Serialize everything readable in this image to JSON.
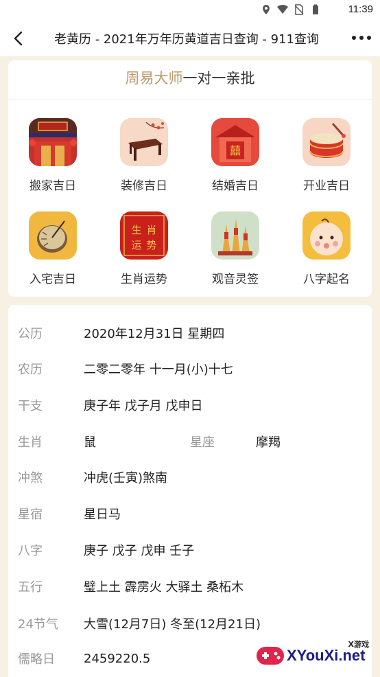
{
  "status_bar": {
    "time": "11:39",
    "icons": [
      "location-icon",
      "wifi-icon",
      "no-sim-icon",
      "battery-icon"
    ]
  },
  "header": {
    "title": "老黄历 - 2021年万年历黄道吉日查询 - 911查询",
    "back_icon": "back-arrow-icon",
    "more_icon": "more-icon"
  },
  "master_card": {
    "title_accent": "周易大师",
    "title_rest": "一对一亲批",
    "items": [
      {
        "label": "搬家吉日",
        "icon": "moving-house-icon"
      },
      {
        "label": "装修吉日",
        "icon": "renovation-table-icon"
      },
      {
        "label": "结婚吉日",
        "icon": "wedding-icon"
      },
      {
        "label": "开业吉日",
        "icon": "drum-icon"
      },
      {
        "label": "入宅吉日",
        "icon": "sundial-icon"
      },
      {
        "label": "生肖运势",
        "icon": "zodiac-fortune-icon"
      },
      {
        "label": "观音灵签",
        "icon": "fortune-sticks-icon"
      },
      {
        "label": "八字起名",
        "icon": "baby-icon"
      }
    ]
  },
  "info": {
    "gongli": {
      "key": "公历",
      "value": "2020年12月31日 星期四"
    },
    "nongli": {
      "key": "农历",
      "value": "二零二零年 十一月(小)十七"
    },
    "ganzhi": {
      "key": "干支",
      "value": "庚子年 戊子月 戊申日"
    },
    "shengxiao": {
      "key": "生肖",
      "value": "鼠"
    },
    "xingzuo": {
      "key": "星座",
      "value": "摩羯"
    },
    "chongsha": {
      "key": "冲煞",
      "value": "冲虎(壬寅)煞南"
    },
    "xingxiu": {
      "key": "星宿",
      "value": "星日马"
    },
    "bazi": {
      "key": "八字",
      "value": "庚子 戊子 戊申 壬子"
    },
    "wuxing": {
      "key": "五行",
      "value": "璧上土 霹雳火 大驿土 桑柘木"
    },
    "jieqi": {
      "key": "24节气",
      "value": "大雪(12月7日) 冬至(12月21日)"
    },
    "rulueri": {
      "key": "儒略日",
      "value": "2459220.5"
    }
  },
  "watermark": {
    "small": "X游戏",
    "big": "XYouXi.net"
  },
  "colors": {
    "accent": "#b99b6b",
    "background": "#f7f0e3"
  }
}
